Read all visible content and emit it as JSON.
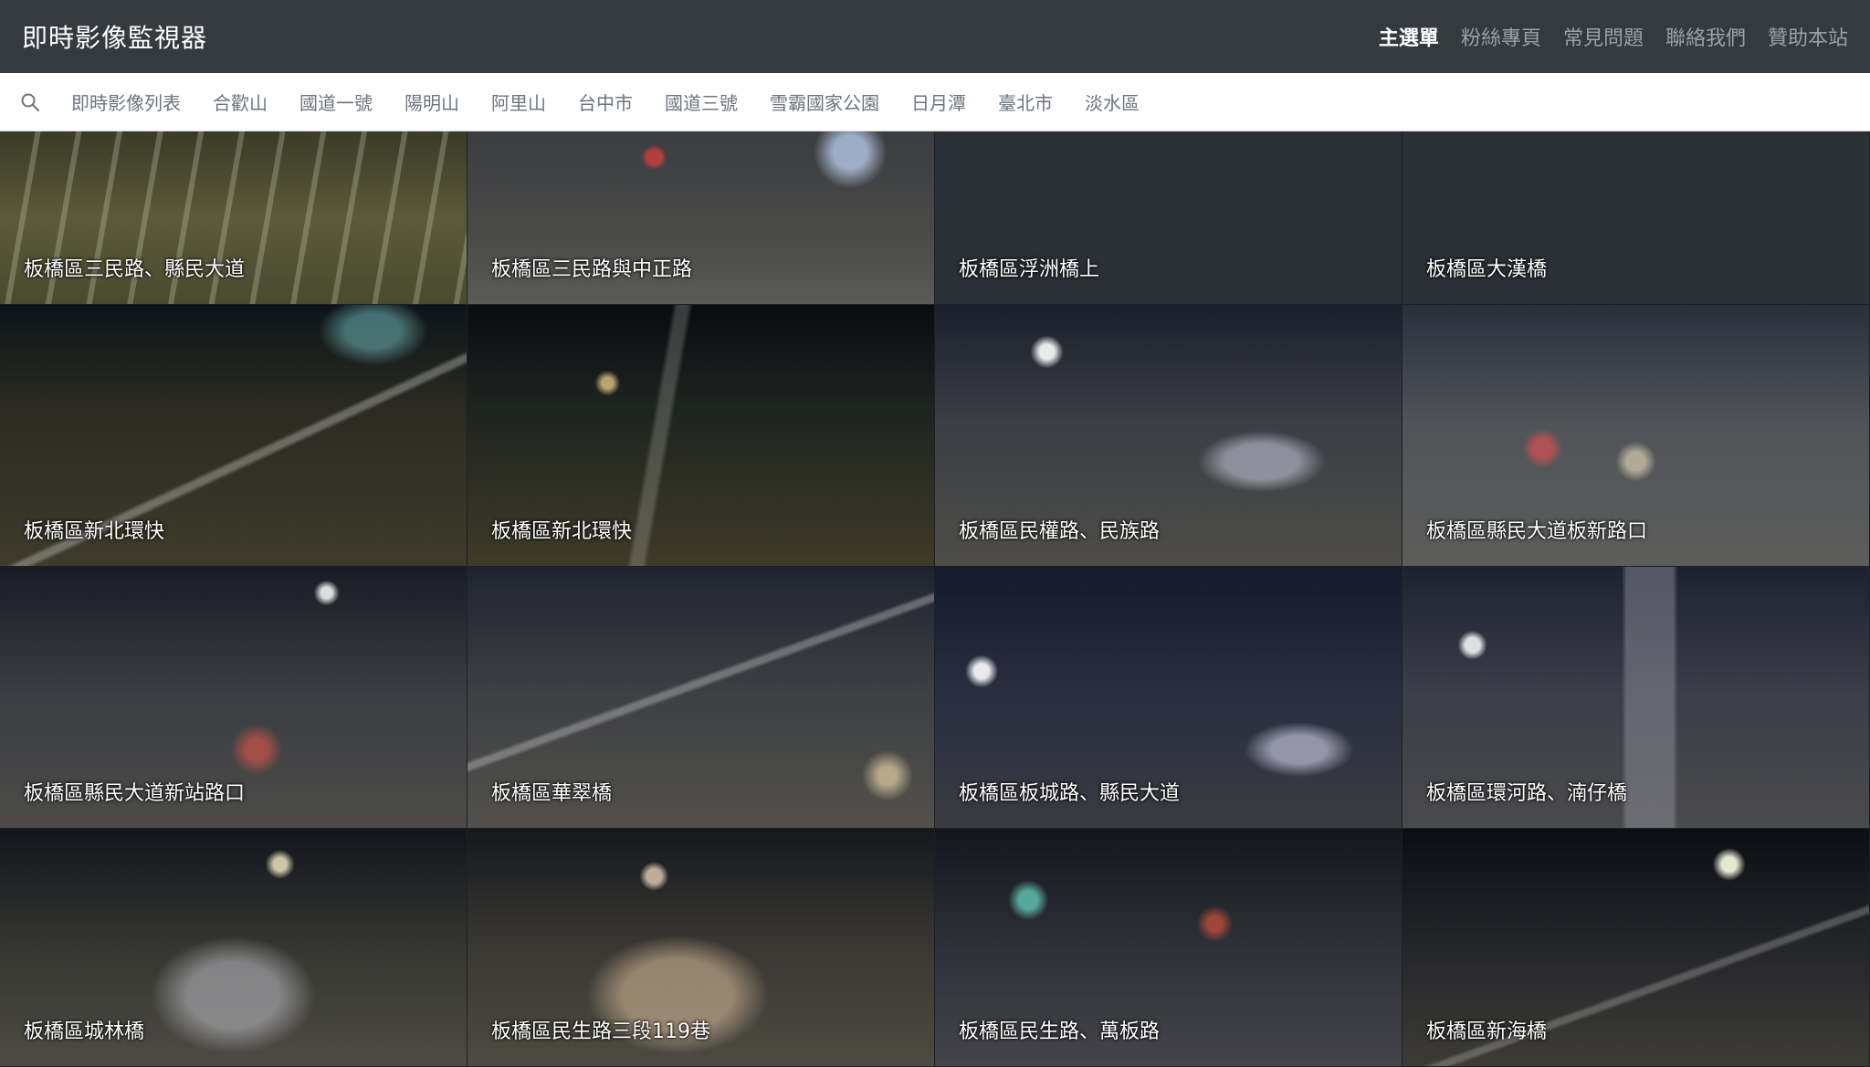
{
  "app": {
    "title": "即時影像監視器"
  },
  "topnav": {
    "items": [
      {
        "label": "主選單",
        "active": true
      },
      {
        "label": "粉絲專頁",
        "active": false
      },
      {
        "label": "常見問題",
        "active": false
      },
      {
        "label": "聯絡我們",
        "active": false
      },
      {
        "label": "贊助本站",
        "active": false
      }
    ]
  },
  "subnav": {
    "search_icon": "search-icon",
    "items": [
      {
        "label": "即時影像列表"
      },
      {
        "label": "合歡山"
      },
      {
        "label": "國道一號"
      },
      {
        "label": "陽明山"
      },
      {
        "label": "阿里山"
      },
      {
        "label": "台中市"
      },
      {
        "label": "國道三號"
      },
      {
        "label": "雪霸國家公園"
      },
      {
        "label": "日月潭"
      },
      {
        "label": "臺北市"
      },
      {
        "label": "淡水區"
      }
    ]
  },
  "cameras": [
    {
      "label": "板橋區三民路、縣民大道"
    },
    {
      "label": "板橋區三民路與中正路"
    },
    {
      "label": "板橋區浮洲橋上"
    },
    {
      "label": "板橋區大漢橋"
    },
    {
      "label": "板橋區新北環快"
    },
    {
      "label": "板橋區新北環快"
    },
    {
      "label": "板橋區民權路、民族路"
    },
    {
      "label": "板橋區縣民大道板新路口"
    },
    {
      "label": "板橋區縣民大道新站路口"
    },
    {
      "label": "板橋區華翠橋"
    },
    {
      "label": "板橋區板城路、縣民大道"
    },
    {
      "label": "板橋區環河路、湳仔橋"
    },
    {
      "label": "板橋區城林橋"
    },
    {
      "label": "板橋區民生路三段119巷"
    },
    {
      "label": "板橋區民生路、萬板路"
    },
    {
      "label": "板橋區新海橋"
    }
  ]
}
